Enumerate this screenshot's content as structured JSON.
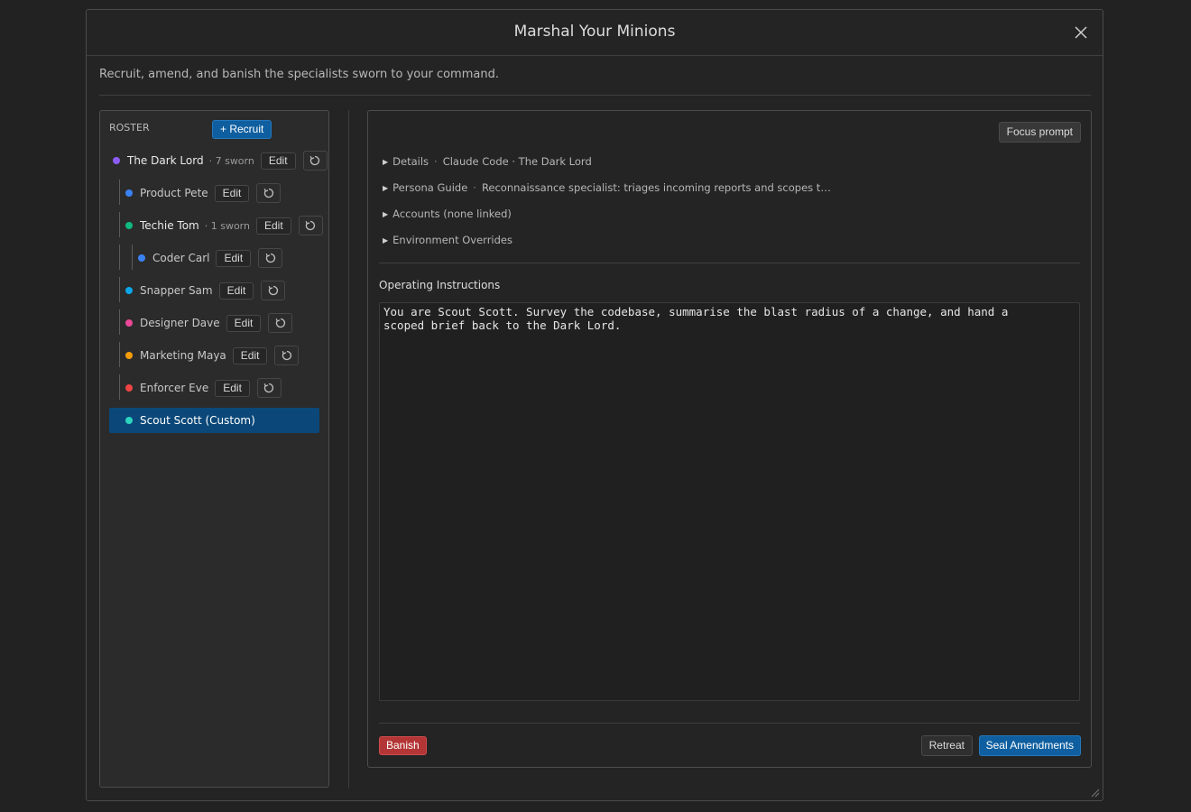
{
  "dialog": {
    "title": "Marshal Your Minions",
    "subtitle": "Recruit, amend, and banish the specialists sworn to your command.",
    "close_icon": "close-icon"
  },
  "roster": {
    "label": "ROSTER",
    "recruit_label": "+ Recruit",
    "edit_label": "Edit",
    "minions": [
      {
        "name": "The Dark Lord",
        "sworn": "· 7 sworn",
        "color": "#8b5cf6"
      },
      {
        "name": "Product Pete",
        "sworn": "",
        "color": "#3b82f6"
      },
      {
        "name": "Techie Tom",
        "sworn": "· 1 sworn",
        "color": "#10b981"
      },
      {
        "name": "Coder Carl",
        "sworn": "",
        "color": "#3b82f6"
      },
      {
        "name": "Snapper Sam",
        "sworn": "",
        "color": "#0ea5e9"
      },
      {
        "name": "Designer Dave",
        "sworn": "",
        "color": "#ec4899"
      },
      {
        "name": "Marketing Maya",
        "sworn": "",
        "color": "#f59e0b"
      },
      {
        "name": "Enforcer Eve",
        "sworn": "",
        "color": "#ef4444"
      },
      {
        "name": "Scout Scott (Custom)",
        "sworn": "",
        "color": "#2dd4bf",
        "selected": true
      }
    ]
  },
  "editor": {
    "focus_label": "Focus prompt",
    "sections": [
      {
        "title": "Details",
        "summary": "Claude Code · The Dark Lord"
      },
      {
        "title": "Persona Guide",
        "summary": "Reconnaissance specialist: triages incoming reports and scopes t…"
      },
      {
        "title": "Accounts (none linked)",
        "summary": ""
      },
      {
        "title": "Environment Overrides",
        "summary": ""
      }
    ],
    "instructions_label": "Operating Instructions",
    "instructions_value": "You are Scout Scott. Survey the codebase, summarise the blast radius of a change, and hand a\nscoped brief back to the Dark Lord.",
    "banish_label": "Banish",
    "retreat_label": "Retreat",
    "seal_label": "Seal Amendments"
  },
  "colors": {
    "accent": "#0f5fa0",
    "danger": "#b33535",
    "selected_row": "#0b4879"
  }
}
